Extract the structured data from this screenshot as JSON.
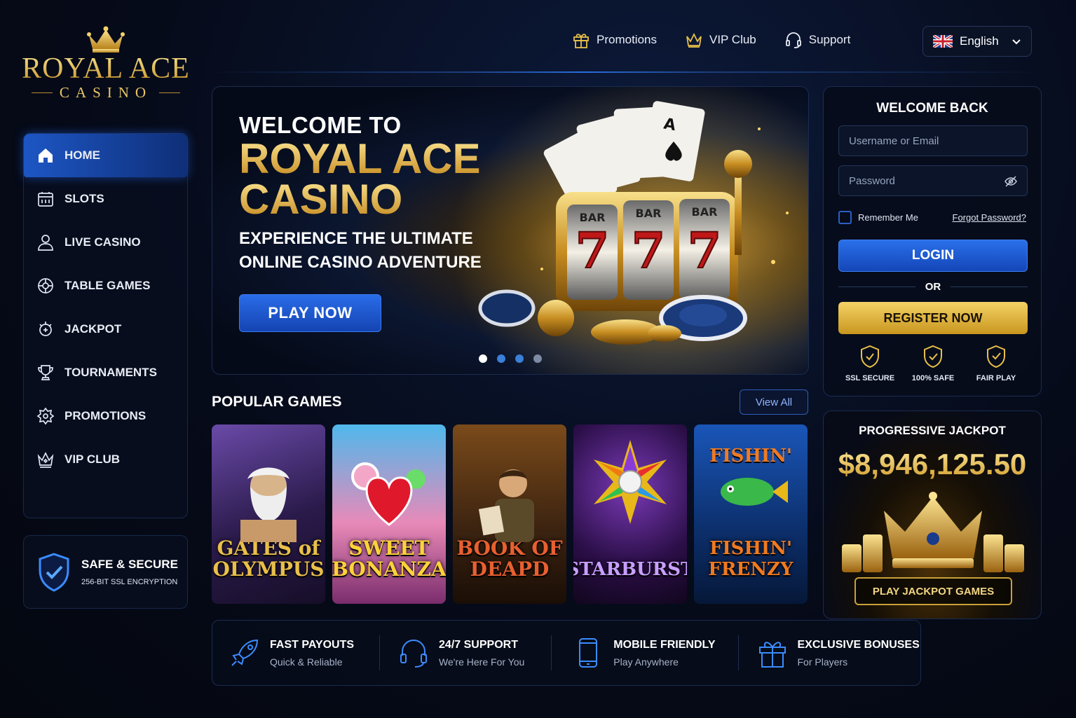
{
  "brand": {
    "name": "ROYAL ACE",
    "sub": "CASINO"
  },
  "topnav": [
    {
      "label": "Promotions",
      "icon": "gift-icon"
    },
    {
      "label": "VIP Club",
      "icon": "crown-icon"
    },
    {
      "label": "Support",
      "icon": "headset-icon"
    }
  ],
  "language": {
    "label": "English",
    "flag": "uk-flag-icon"
  },
  "sidebar": {
    "items": [
      {
        "label": "HOME",
        "icon": "home-icon",
        "active": true
      },
      {
        "label": "SLOTS",
        "icon": "slot-machine-icon"
      },
      {
        "label": "LIVE CASINO",
        "icon": "person-icon"
      },
      {
        "label": "TABLE GAMES",
        "icon": "roulette-icon"
      },
      {
        "label": "JACKPOT",
        "icon": "jackpot-icon"
      },
      {
        "label": "TOURNAMENTS",
        "icon": "trophy-icon"
      },
      {
        "label": "PROMOTIONS",
        "icon": "star-badge-icon"
      },
      {
        "label": "VIP CLUB",
        "icon": "crown-icon"
      }
    ]
  },
  "secure": {
    "title": "SAFE & SECURE",
    "subtitle": "256-BIT SSL ENCRYPTION"
  },
  "hero": {
    "welcome": "WELCOME TO",
    "line1": "ROYAL ACE",
    "line2": "CASINO",
    "tag1": "EXPERIENCE THE ULTIMATE",
    "tag2": "ONLINE CASINO ADVENTURE",
    "cta": "PLAY NOW",
    "slides": 4,
    "active_slide": 1
  },
  "popular": {
    "title": "POPULAR GAMES",
    "view_all": "View All",
    "games": [
      {
        "title1": "GATES of",
        "title2": "OLYMPUS"
      },
      {
        "title1": "SWEET",
        "title2": "BONANZA"
      },
      {
        "title1": "BOOK OF",
        "title2": "DEAPD"
      },
      {
        "title1": "STARBURST",
        "title2": ""
      },
      {
        "title1": "FISHIN' FRENZY",
        "title2": "FISHIN'"
      }
    ]
  },
  "login": {
    "title": "WELCOME BACK",
    "username_placeholder": "Username or Email",
    "password_placeholder": "Password",
    "remember": "Remember Me",
    "forgot": "Forgot Password?",
    "login_btn": "LOGIN",
    "or": "OR",
    "register_btn": "REGISTER NOW",
    "badges": [
      "SSL SECURE",
      "100% SAFE",
      "FAIR PLAY"
    ]
  },
  "jackpot": {
    "title": "PROGRESSIVE JACKPOT",
    "amount": "$8,946,125.50",
    "cta": "PLAY JACKPOT GAMES"
  },
  "features": [
    {
      "title": "FAST PAYOUTS",
      "sub": "Quick & Reliable",
      "icon": "rocket-icon"
    },
    {
      "title": "24/7 SUPPORT",
      "sub": "We're Here For You",
      "icon": "headset-icon"
    },
    {
      "title": "MOBILE FRIENDLY",
      "sub": "Play Anywhere",
      "icon": "mobile-icon"
    },
    {
      "title": "EXCLUSIVE BONUSES",
      "sub": "For Players",
      "icon": "gift-icon"
    }
  ],
  "colors": {
    "gold": "#e8bf4a",
    "blue": "#1d56c4",
    "bg": "#060b1a"
  }
}
